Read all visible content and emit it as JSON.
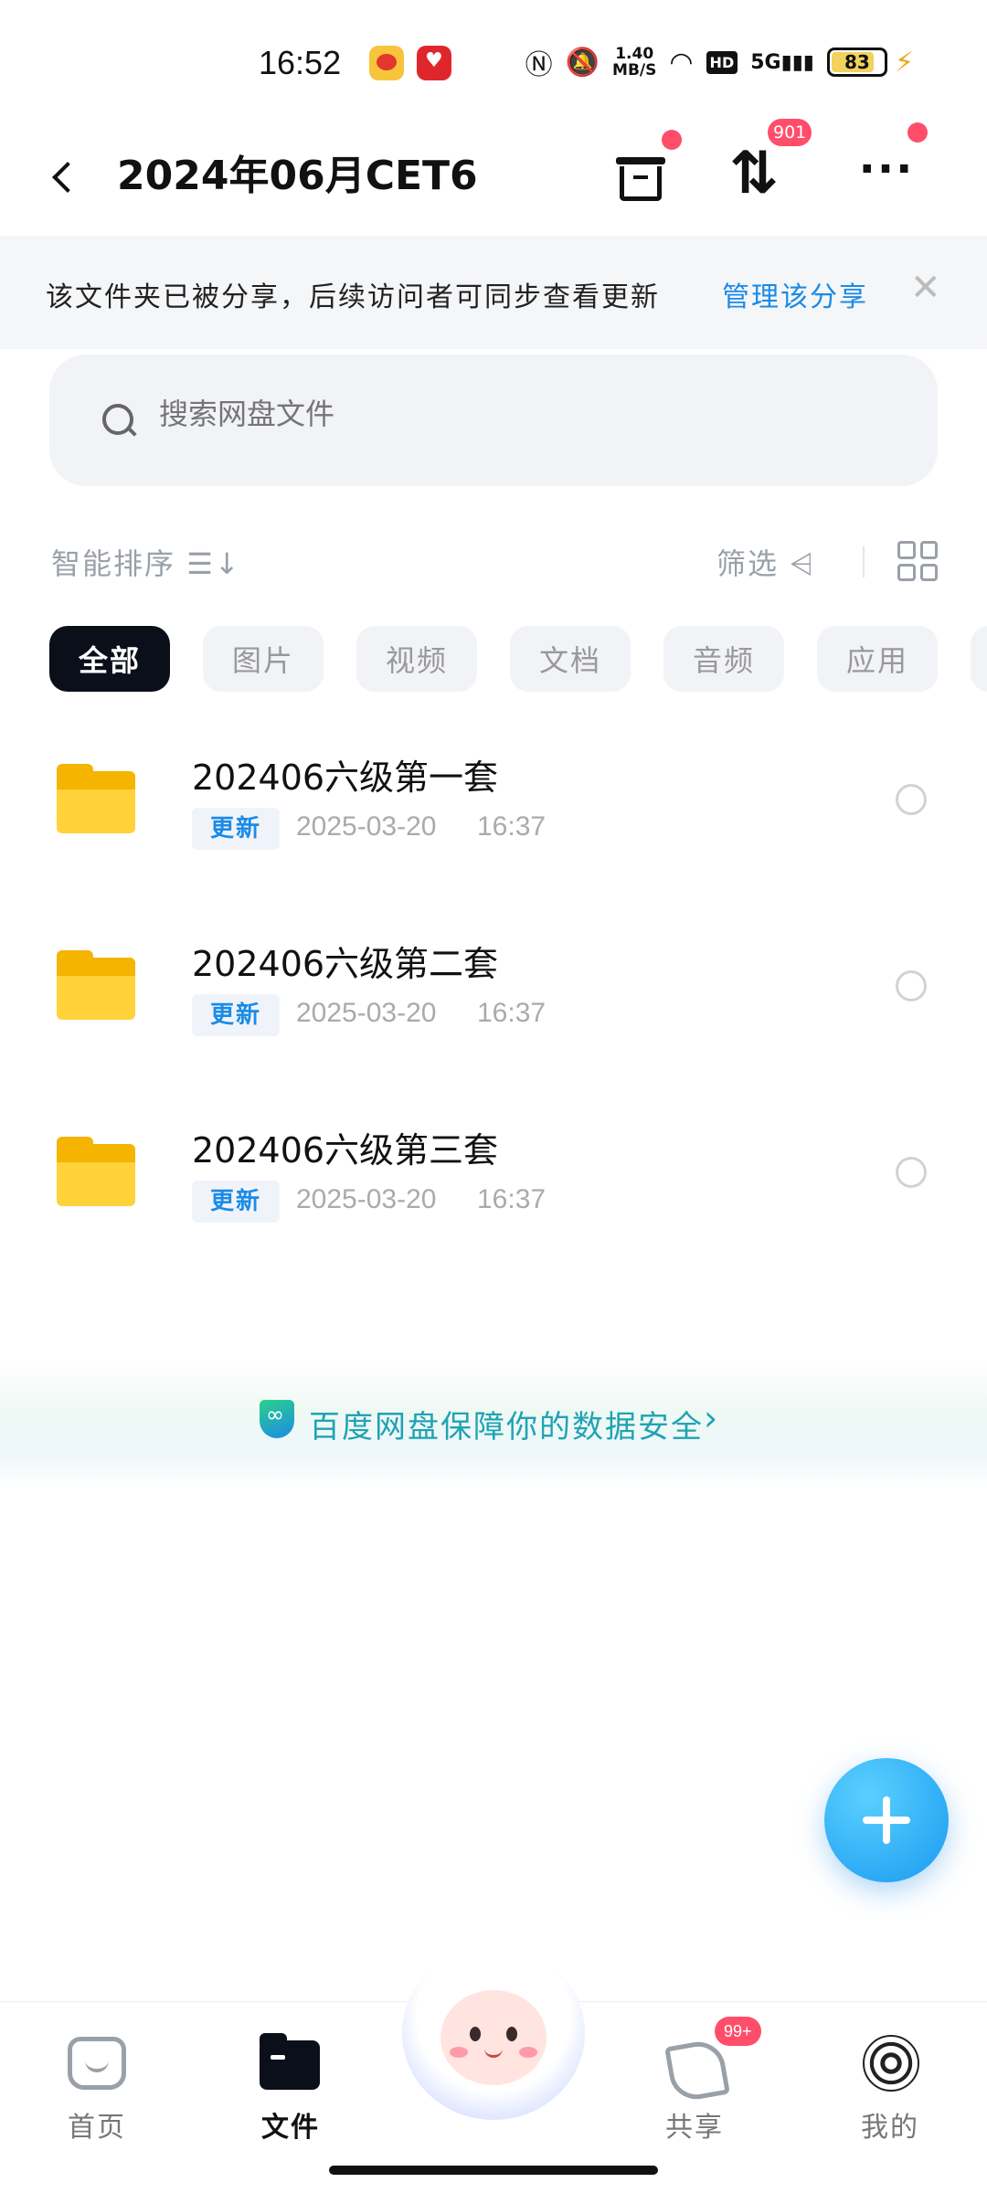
{
  "status_bar": {
    "time": "16:52",
    "net_speed": "1.40",
    "net_unit": "MB/S",
    "hd": "HD",
    "signal": "5G",
    "battery": "83",
    "battery_level": 0.83,
    "icons": [
      "weibo-icon",
      "pdd-icon",
      "nfc-icon",
      "mute-icon",
      "wifi-icon",
      "signal-icon",
      "battery-icon",
      "charging-icon"
    ]
  },
  "header": {
    "title": "2024年06月CET6",
    "transfer_count": "901"
  },
  "share_notice": {
    "text": "该文件夹已被分享，后续访问者可同步查看更新",
    "link": "管理该分享",
    "close": "✕"
  },
  "search": {
    "placeholder": "搜索网盘文件"
  },
  "toolbar": {
    "sort_label": "智能排序",
    "sort_glyph": "☰↓",
    "filter_label": "筛选",
    "filter_glyph": "⩤"
  },
  "categories": [
    "全部",
    "图片",
    "视频",
    "文档",
    "音频",
    "应用"
  ],
  "files": [
    {
      "name": "202406六级第一套",
      "tag": "更新",
      "date": "2025-03-20",
      "time": "16:37"
    },
    {
      "name": "202406六级第二套",
      "tag": "更新",
      "date": "2025-03-20",
      "time": "16:37"
    },
    {
      "name": "202406六级第三套",
      "tag": "更新",
      "date": "2025-03-20",
      "time": "16:37"
    }
  ],
  "security_banner": {
    "text": "百度网盘保障你的数据安全",
    "chevron": "›"
  },
  "bottom_nav": {
    "home": "首页",
    "files": "文件",
    "share": "共享",
    "share_badge": "99+",
    "mine": "我的"
  },
  "colors": {
    "accent": "#1b8be6",
    "badge": "#ff4d6a",
    "chip_active": "#0b0f1a",
    "folder": "#ffd23a"
  }
}
